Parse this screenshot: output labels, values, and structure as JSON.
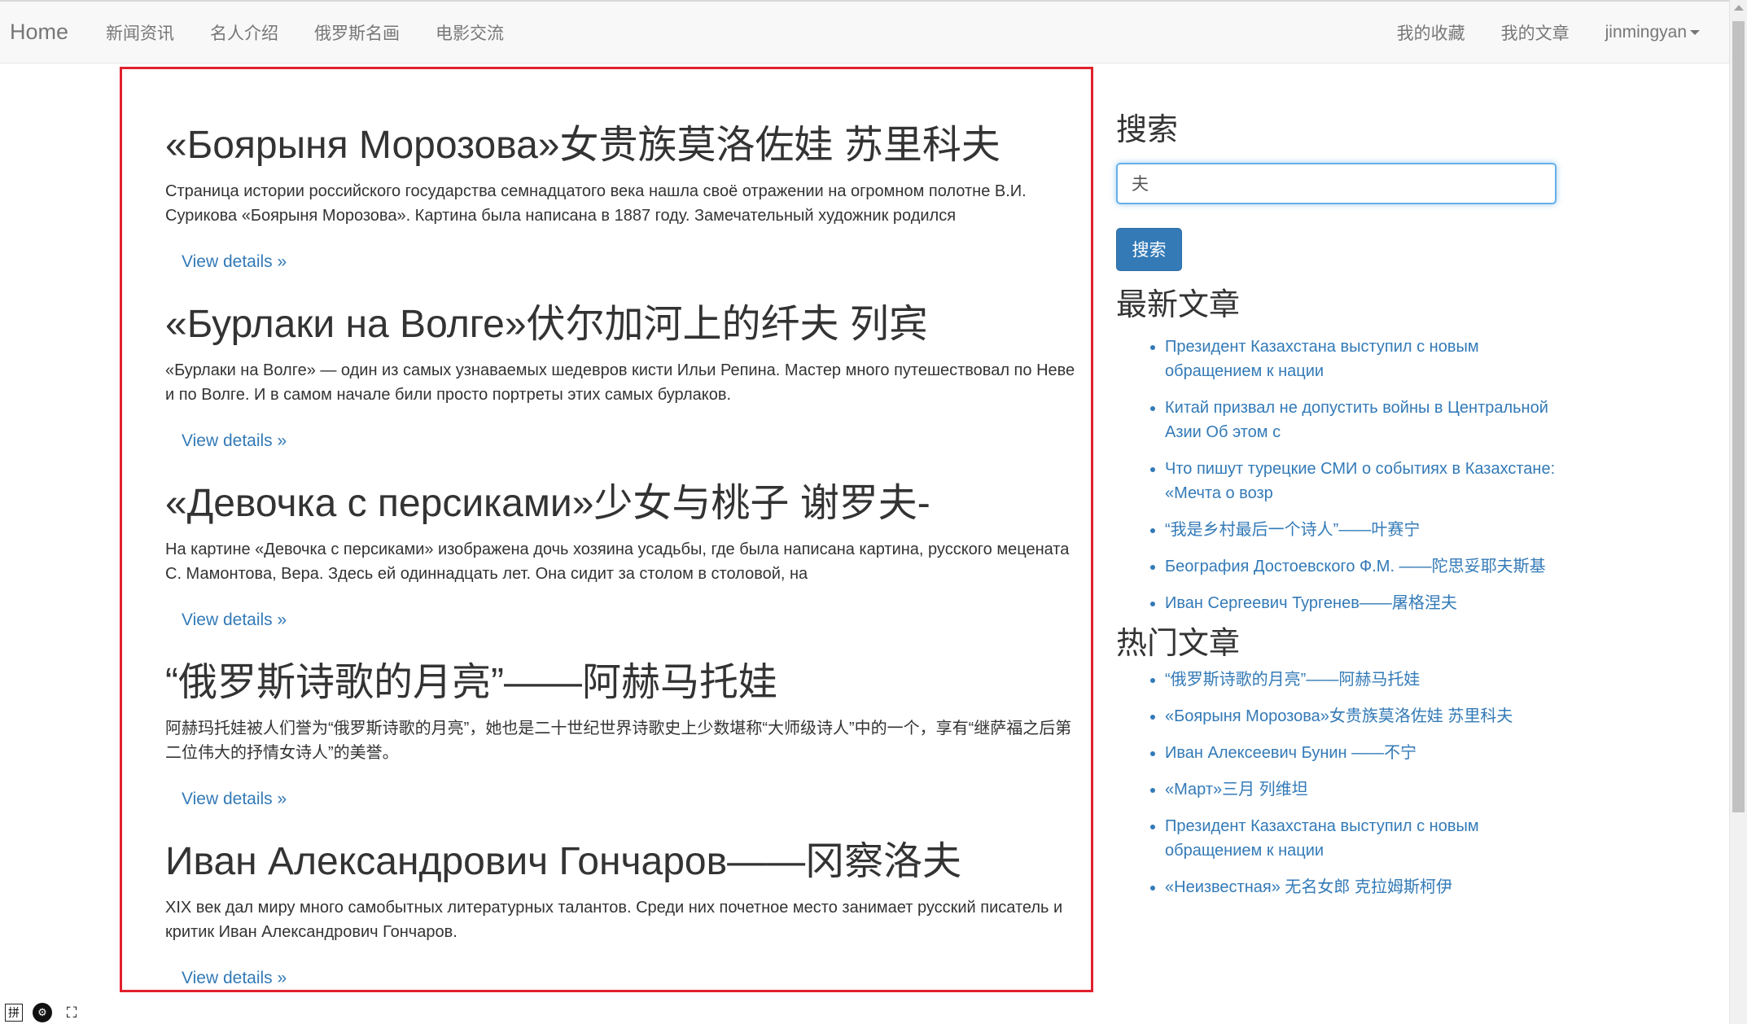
{
  "nav": {
    "brand": "Home",
    "left_items": [
      "新闻资讯",
      "名人介绍",
      "俄罗斯名画",
      "电影交流"
    ],
    "right_items": [
      "我的收藏",
      "我的文章"
    ],
    "user": "jinmingyan"
  },
  "articles": [
    {
      "title": "«Боярыня Морозова»女贵族莫洛佐娃 苏里科夫",
      "excerpt": "Страница истории российского государства семнадцатого века нашла своё отражении на огромном полотне В.И. Сурикова «Боярыня Морозова». Картина была написана в 1887 году. Замечательный художник родился",
      "link": "View details »"
    },
    {
      "title": "«Бурлаки на Волге»伏尔加河上的纤夫 列宾",
      "excerpt": "«Бурлаки на Волге» — один из самых узнаваемых шедевров кисти Ильи Репина. Мастер много путешествовал по Неве и по Волге. И в самом начале били просто портреты этих самых бурлаков.",
      "link": "View details »"
    },
    {
      "title": "«Девочка с персиками»少女与桃子 谢罗夫-",
      "excerpt": "На картине «Девочка с персиками» изображена дочь хозяина усадьбы, где была написана картина, русского мецената С. Мамонтова, Вера. Здесь ей одиннадцать лет. Она сидит за столом в столовой, на",
      "link": "View details »"
    },
    {
      "title": "“俄罗斯诗歌的月亮”——阿赫马托娃",
      "excerpt": "阿赫玛托娃被人们誉为“俄罗斯诗歌的月亮”，她也是二十世纪世界诗歌史上少数堪称“大师级诗人”中的一个，享有“继萨福之后第二位伟大的抒情女诗人”的美誉。",
      "link": "View details »"
    },
    {
      "title": "Иван Александрович Гончаров——冈察洛夫",
      "excerpt": "XIX век дал миру много самобытных литературных талантов. Среди них почетное место занимает русский писатель и критик Иван Александрович Гончаров.",
      "link": "View details »"
    }
  ],
  "sidebar": {
    "search_heading": "搜索",
    "search_value": "夫",
    "search_button": "搜索",
    "latest_heading": "最新文章",
    "latest": [
      "Президент Казахстана выступил с новым обращением к нации",
      "Китай призвал не допустить войны в Центральной Азии Об этом с",
      "Что пишут турецкие СМИ о событиях в Казахстане: «Мечта о возр",
      "“我是乡村最后一个诗人”——叶赛宁",
      "Беография Достоевского Ф.М. ——陀思妥耶夫斯基",
      "Иван Сергеевич Тургенев——屠格涅夫"
    ],
    "popular_heading": "热门文章",
    "popular": [
      "“俄罗斯诗歌的月亮”——阿赫马托娃",
      "«Боярыня Морозова»女贵族莫洛佐娃 苏里科夫",
      "Иван Алексеевич Бунин ——不宁",
      "«Март»三月 列维坦",
      "Президент Казахстана выступил с новым обращением к нации",
      "«Неизвестная» 无名女郎 克拉姆斯柯伊"
    ]
  },
  "tray": {
    "ime_label": "拼"
  },
  "icons": [
    "pinyin-ime-icon",
    "settings-gear-icon",
    "fullscreen-bracket-icon",
    "caret-down-icon"
  ],
  "colors": {
    "link": "#337ab7",
    "highlight_border": "#e0202c",
    "navbar_bg": "#f8f8f8",
    "button_bg": "#337ab7"
  }
}
